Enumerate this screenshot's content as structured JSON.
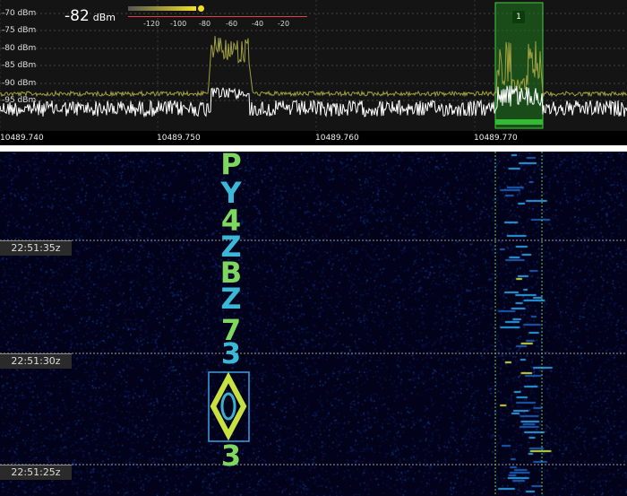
{
  "spectrum": {
    "level_value": "-82",
    "level_unit": "dBm",
    "meter_scale": [
      "-120",
      "-100",
      "-80",
      "-60",
      "-40",
      "-20"
    ],
    "dbm_labels": [
      "-70 dBm",
      "-75 dBm",
      "-80 dBm",
      "-85 dBm",
      "-90 dBm",
      "-95 dBm"
    ],
    "freq_labels": [
      "10489.740",
      "10489.750",
      "10489.760",
      "10489.770"
    ],
    "vfo_number": "1"
  },
  "waterfall": {
    "time_labels": [
      "22:51:35z",
      "22:51:30z",
      "22:51:25z"
    ],
    "decoded_text": [
      "P",
      "Y",
      "4",
      "Z",
      "B",
      "Z",
      "7",
      "3",
      "3"
    ]
  },
  "colors": {
    "vfo": "#22aa22",
    "trace_peak": "#a0a040",
    "trace_live": "#ffffff",
    "waterfall_bg": "#02021a",
    "signal_hot": "#d8e83a",
    "signal_mid": "#2a9adf"
  }
}
